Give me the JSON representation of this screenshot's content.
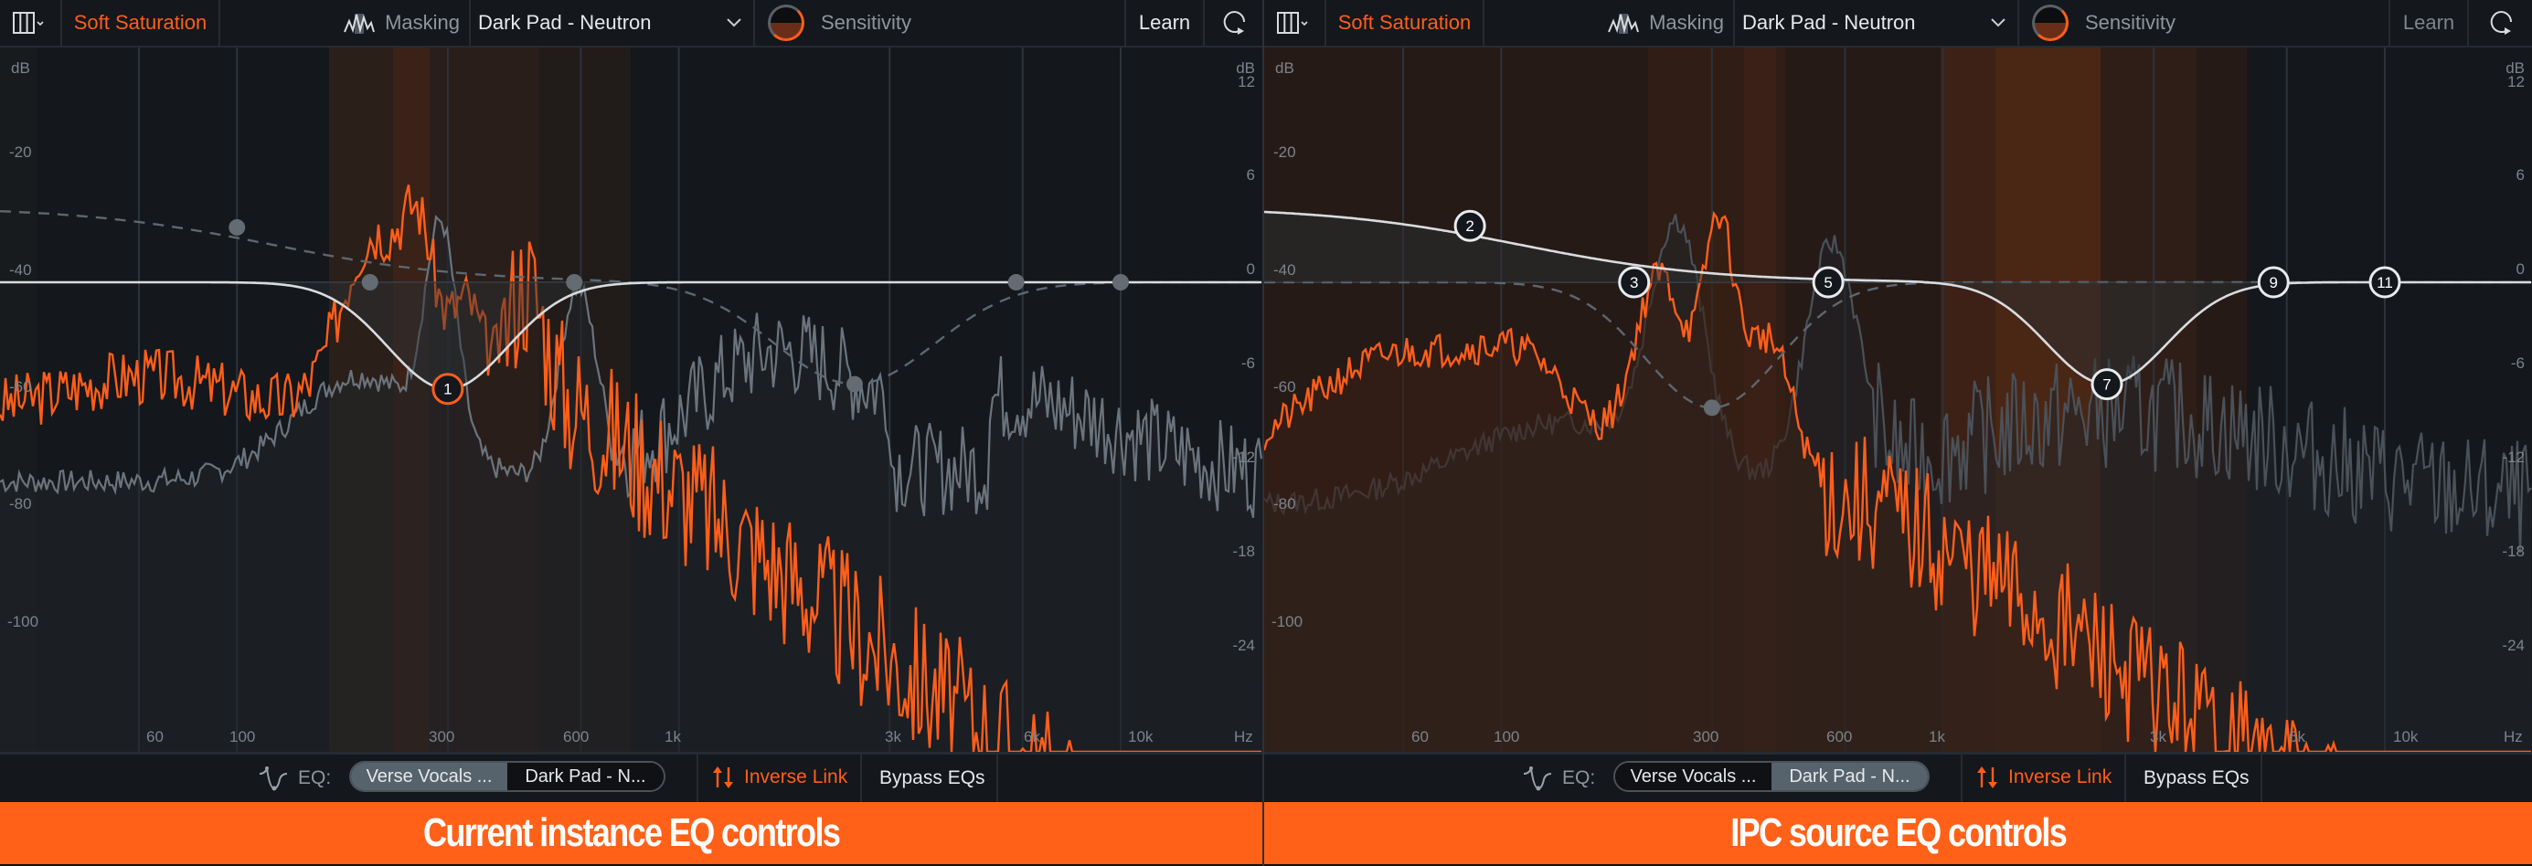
{
  "colors": {
    "accent": "#ff5e1a",
    "caption_bg": "#ff6119",
    "curve": "#d9dcdf",
    "spectrum_gray": "#6b747d",
    "gridline": "#2c333a"
  },
  "axes": {
    "left_db_unit": "dB",
    "left_db_ticks": [
      "-20",
      "-40",
      "-60",
      "-80",
      "-100"
    ],
    "right_db_unit": "dB",
    "right_db_ticks": [
      "12",
      "6",
      "0",
      "-6",
      "-12",
      "-18",
      "-24"
    ],
    "freq_ticks": [
      "60",
      "100",
      "300",
      "600",
      "1k",
      "3k",
      "6k",
      "10k"
    ],
    "freq_unit": "Hz"
  },
  "panels": [
    {
      "id": "current",
      "header": {
        "layout_icon": "columns-icon",
        "mode": "Soft Saturation",
        "masking_icon": "waveform-icon",
        "masking_label": "Masking",
        "preset": "Dark Pad - Neutron",
        "sensitivity_label": "Sensitivity",
        "sensitivity_value": 0.5,
        "learn_label": "Learn",
        "learn_enabled": true,
        "loop_icon": "loop-icon"
      },
      "eq_bar": {
        "eq_icon": "eq-curve-icon",
        "eq_label": "EQ:",
        "options": [
          "Verse Vocals ...",
          "Dark Pad - N..."
        ],
        "active_index": 0,
        "inverse_link_label": "Inverse Link",
        "bypass_label": "Bypass EQs"
      },
      "caption": "Current instance EQ controls",
      "nodes": [
        {
          "label": "1",
          "freq": 300,
          "gain_db": -6.8,
          "selected": true
        }
      ],
      "ghost_nodes": [
        {
          "freq": 100,
          "gain_db": 3.5
        },
        {
          "freq": 200,
          "gain_db": 0
        },
        {
          "freq": 580,
          "gain_db": 0
        },
        {
          "freq": 2500,
          "gain_db": -6.5
        },
        {
          "freq": 5800,
          "gain_db": 0
        },
        {
          "freq": 10000,
          "gain_db": 0
        }
      ]
    },
    {
      "id": "ipc",
      "header": {
        "layout_icon": "columns-icon",
        "mode": "Soft Saturation",
        "masking_icon": "waveform-icon",
        "masking_label": "Masking",
        "preset": "Dark Pad - Neutron",
        "sensitivity_label": "Sensitivity",
        "sensitivity_value": 0.5,
        "learn_label": "Learn",
        "learn_enabled": false,
        "loop_icon": "loop-icon"
      },
      "eq_bar": {
        "eq_icon": "eq-curve-icon",
        "eq_label": "EQ:",
        "options": [
          "Verse Vocals ...",
          "Dark Pad - N..."
        ],
        "active_index": 1,
        "inverse_link_label": "Inverse Link",
        "bypass_label": "Bypass EQs"
      },
      "caption": "IPC source EQ controls",
      "nodes": [
        {
          "label": "2",
          "freq": 85,
          "gain_db": 3.6,
          "selected": false
        },
        {
          "label": "3",
          "freq": 200,
          "gain_db": 0,
          "selected": false
        },
        {
          "label": "5",
          "freq": 550,
          "gain_db": 0,
          "selected": false
        },
        {
          "label": "7",
          "freq": 2350,
          "gain_db": -6.5,
          "selected": false
        },
        {
          "label": "9",
          "freq": 5600,
          "gain_db": 0,
          "selected": false
        },
        {
          "label": "11",
          "freq": 10000,
          "gain_db": 0,
          "selected": false
        }
      ],
      "ghost_nodes": [
        {
          "freq": 300,
          "gain_db": -8.0
        }
      ]
    }
  ]
}
